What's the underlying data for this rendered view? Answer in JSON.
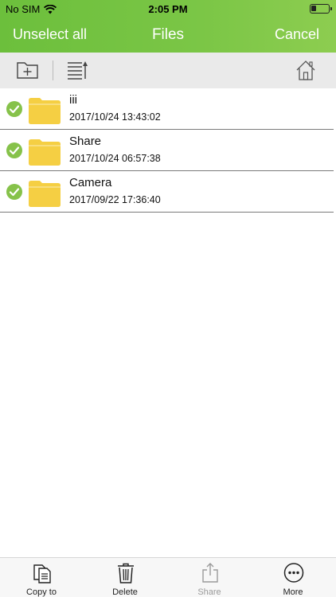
{
  "status_bar": {
    "carrier": "No SIM",
    "time": "2:05 PM"
  },
  "nav": {
    "left_label": "Unselect all",
    "title": "Files",
    "right_label": "Cancel"
  },
  "colors": {
    "header_start": "#6cbf3c",
    "header_end": "#8dcd50",
    "checkmark": "#86c24a",
    "folder": "#f5cf43"
  },
  "toolbar": {
    "new_folder_icon": "folder-plus-icon",
    "sort_icon": "sort-list-icon",
    "home_icon": "home-icon"
  },
  "files": [
    {
      "name": "iii",
      "date": "2017/10/24 13:43:02",
      "selected": true
    },
    {
      "name": "Share",
      "date": "2017/10/24 06:57:38",
      "selected": true
    },
    {
      "name": "Camera",
      "date": "2017/09/22 17:36:40",
      "selected": true
    }
  ],
  "tabbar": {
    "copy_label": "Copy to",
    "delete_label": "Delete",
    "share_label": "Share",
    "more_label": "More"
  }
}
